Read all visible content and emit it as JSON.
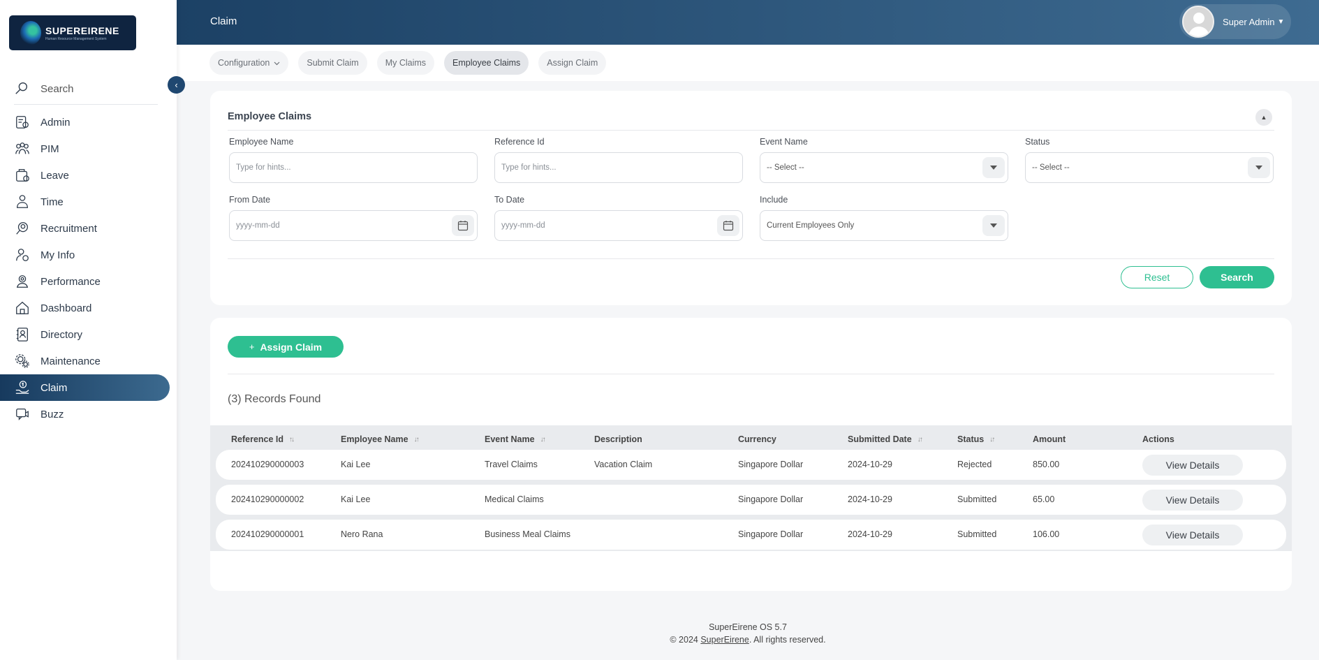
{
  "brand": {
    "name": "SUPEREIRENE",
    "tagline": "Human Resource Management System"
  },
  "sidebar": {
    "search_label": "Search",
    "items": [
      {
        "label": "Admin",
        "icon": "admin-icon"
      },
      {
        "label": "PIM",
        "icon": "pim-icon"
      },
      {
        "label": "Leave",
        "icon": "leave-icon"
      },
      {
        "label": "Time",
        "icon": "time-icon"
      },
      {
        "label": "Recruitment",
        "icon": "recruitment-icon"
      },
      {
        "label": "My Info",
        "icon": "my-info-icon"
      },
      {
        "label": "Performance",
        "icon": "performance-icon"
      },
      {
        "label": "Dashboard",
        "icon": "dashboard-icon"
      },
      {
        "label": "Directory",
        "icon": "directory-icon"
      },
      {
        "label": "Maintenance",
        "icon": "maintenance-icon"
      },
      {
        "label": "Claim",
        "icon": "claim-icon",
        "active": true
      },
      {
        "label": "Buzz",
        "icon": "buzz-icon"
      }
    ]
  },
  "header": {
    "title": "Claim",
    "user_name": "Super Admin"
  },
  "tabs": [
    {
      "label": "Configuration"
    },
    {
      "label": "Submit Claim"
    },
    {
      "label": "My Claims"
    },
    {
      "label": "Employee Claims",
      "active": true
    },
    {
      "label": "Assign Claim"
    }
  ],
  "filter": {
    "title": "Employee Claims",
    "employee_name": {
      "label": "Employee Name",
      "placeholder": "Type for hints..."
    },
    "reference_id": {
      "label": "Reference Id",
      "placeholder": "Type for hints..."
    },
    "event_name": {
      "label": "Event Name",
      "value": "-- Select --"
    },
    "status": {
      "label": "Status",
      "value": "-- Select --"
    },
    "from_date": {
      "label": "From Date",
      "placeholder": "yyyy-mm-dd"
    },
    "to_date": {
      "label": "To Date",
      "placeholder": "yyyy-mm-dd"
    },
    "include": {
      "label": "Include",
      "value": "Current Employees Only"
    },
    "reset_label": "Reset",
    "search_label": "Search"
  },
  "records": {
    "assign_label": "Assign Claim",
    "count_text": "(3) Records Found",
    "columns": [
      "Reference Id",
      "Employee Name",
      "Event Name",
      "Description",
      "Currency",
      "Submitted Date",
      "Status",
      "Amount",
      "Actions"
    ],
    "rows": [
      {
        "reference_id": "202410290000003",
        "employee_name": "Kai Lee",
        "event_name": "Travel Claims",
        "description": "Vacation Claim",
        "currency": "Singapore Dollar",
        "submitted_date": "2024-10-29",
        "status": "Rejected",
        "amount": "850.00",
        "action": "View Details"
      },
      {
        "reference_id": "202410290000002",
        "employee_name": "Kai Lee",
        "event_name": "Medical Claims",
        "description": "",
        "currency": "Singapore Dollar",
        "submitted_date": "2024-10-29",
        "status": "Submitted",
        "amount": "65.00",
        "action": "View Details"
      },
      {
        "reference_id": "202410290000001",
        "employee_name": "Nero Rana",
        "event_name": "Business Meal Claims",
        "description": "",
        "currency": "Singapore Dollar",
        "submitted_date": "2024-10-29",
        "status": "Submitted",
        "amount": "106.00",
        "action": "View Details"
      }
    ]
  },
  "footer": {
    "version": "SuperEirene OS 5.7",
    "copyright_prefix": "© 2024 ",
    "link": "SuperEirene",
    "copyright_suffix": ". All rights reserved."
  },
  "colors": {
    "accent": "#2ebf91",
    "header_dark": "#1c4165",
    "header_light": "#3e6b91",
    "sidebar_active": "#173a5e"
  }
}
